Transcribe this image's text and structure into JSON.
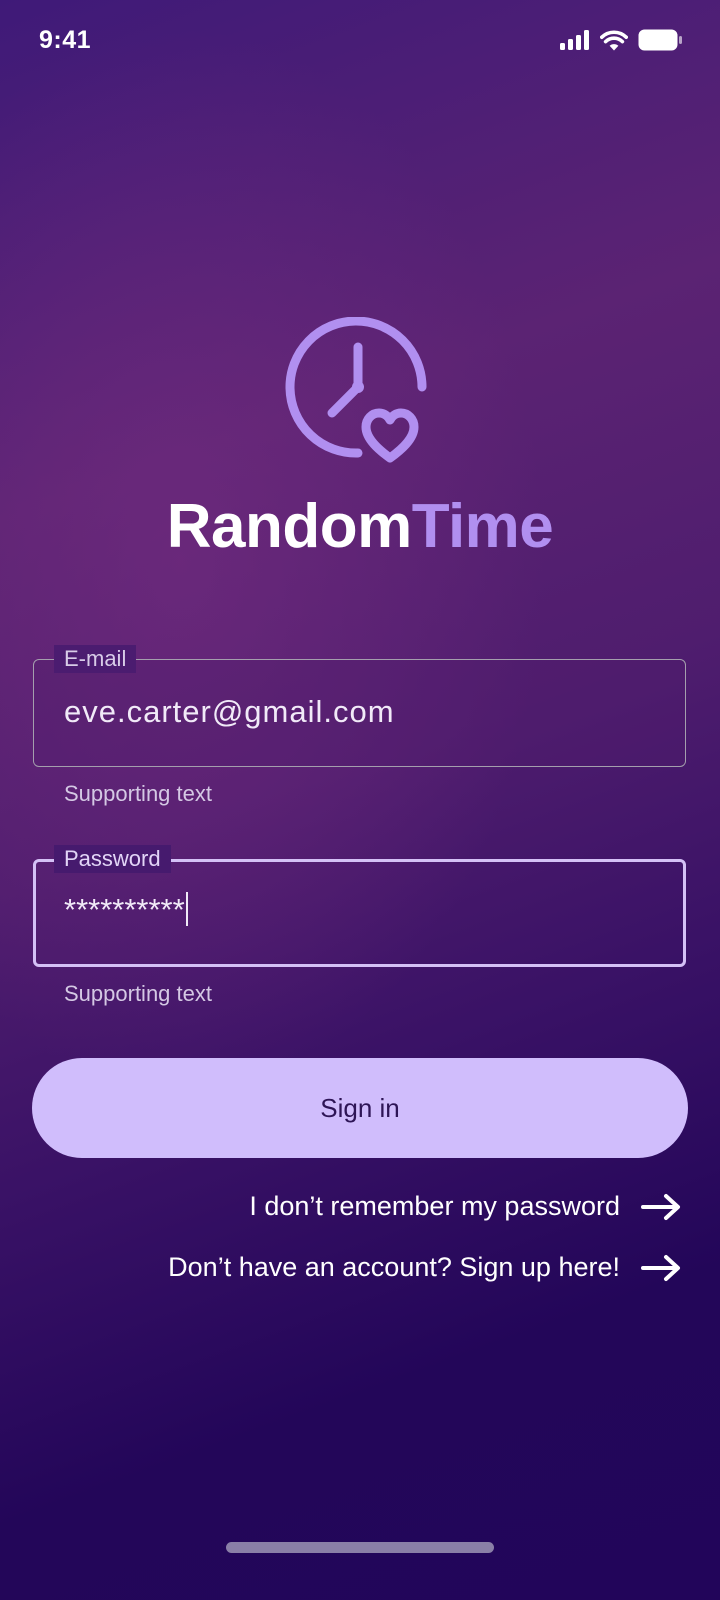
{
  "status_bar": {
    "time": "9:41",
    "icons": [
      "cellular-signal-icon",
      "wifi-icon",
      "battery-icon"
    ]
  },
  "brand": {
    "logo_icon": "clock-heart-icon",
    "name_part1": "Random",
    "name_part2": "Time",
    "accent_color": "#b18ff0"
  },
  "email_field": {
    "label": "E-mail",
    "value": "eve.carter@gmail.com",
    "supporting_text": "Supporting text"
  },
  "password_field": {
    "label": "Password",
    "value": "**********",
    "supporting_text": "Supporting text",
    "focused": true
  },
  "actions": {
    "sign_in_label": "Sign in",
    "forgot_password_label": "I don’t remember my password",
    "sign_up_label": "Don’t have an account? Sign up here!"
  },
  "colors": {
    "primary_button": "#d0bdfc",
    "primary_button_text": "#2e1556",
    "background_dark": "#22055a",
    "background_mid": "#5b2373"
  }
}
